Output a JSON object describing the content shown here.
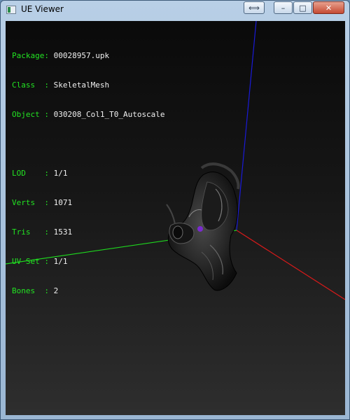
{
  "window": {
    "title": "UE Viewer",
    "controls": {
      "extra_label": "⟺",
      "minimize_label": "–",
      "maximize_label": "□",
      "close_label": "✕"
    }
  },
  "info": {
    "package": {
      "key": "Package:",
      "value": "00028957.upk"
    },
    "class": {
      "key": "Class  :",
      "value": "SkeletalMesh"
    },
    "object": {
      "key": "Object :",
      "value": "030208_Col1_T0_Autoscale"
    },
    "lod": {
      "key": "LOD    :",
      "value": "1/1"
    },
    "verts": {
      "key": "Verts  :",
      "value": "1071"
    },
    "tris": {
      "key": "Tris   :",
      "value": "1531"
    },
    "uvset": {
      "key": "UV Set :",
      "value": "1/1"
    },
    "bones": {
      "key": "Bones  :",
      "value": "2"
    }
  },
  "colors": {
    "label": "#22e322",
    "value": "#f0f0f0",
    "axis_x": "#d01010",
    "axis_y": "#10d010",
    "axis_z": "#1010d0"
  }
}
